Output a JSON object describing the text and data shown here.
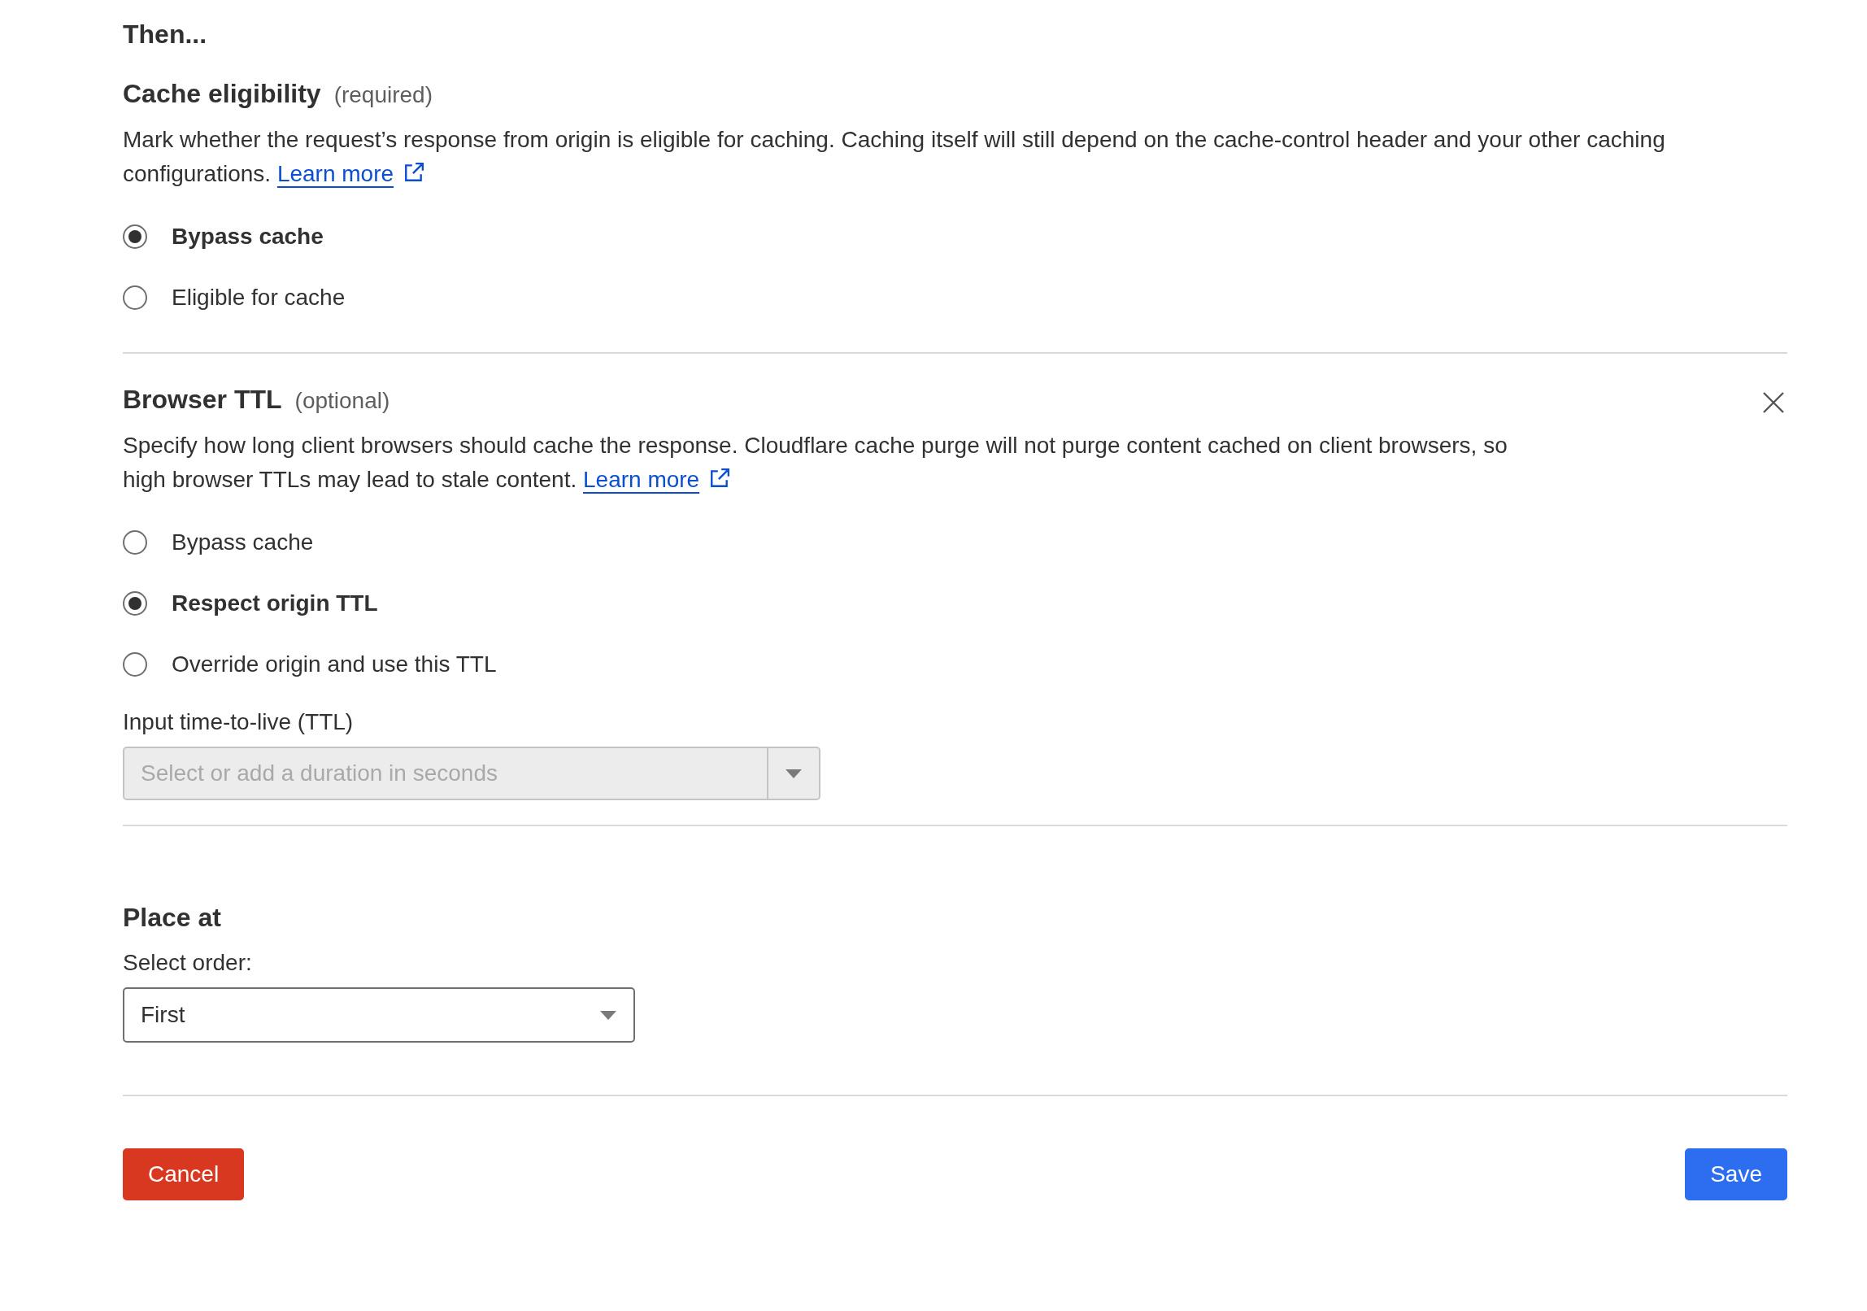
{
  "heading": "Then...",
  "sections": [
    {
      "title": "Cache eligibility",
      "qualifier": "(required)",
      "closable": false,
      "description": "Mark whether the request’s response from origin is eligible for caching. Caching itself will still depend on the cache-control header and your other caching configurations.",
      "link": "Learn more",
      "options": [
        {
          "label": "Bypass cache",
          "selected": true
        },
        {
          "label": "Eligible for cache",
          "selected": false
        }
      ]
    },
    {
      "title": "Browser TTL",
      "qualifier": "(optional)",
      "closable": true,
      "description": "Specify how long client browsers should cache the response. Cloudflare cache purge will not purge content cached on client browsers, so high browser TTLs may lead to stale content.",
      "link": "Learn more",
      "options": [
        {
          "label": "Bypass cache",
          "selected": false
        },
        {
          "label": "Respect origin TTL",
          "selected": true
        },
        {
          "label": "Override origin and use this TTL",
          "selected": false
        }
      ],
      "ttl_field": {
        "label": "Input time-to-live (TTL)",
        "placeholder": "Select or add a duration in seconds",
        "disabled": true
      }
    }
  ],
  "place_at": {
    "title": "Place at",
    "label": "Select order:",
    "value": "First"
  },
  "buttons": [
    {
      "label": "Cancel",
      "kind": "danger"
    },
    {
      "label": "Save",
      "kind": "primary"
    }
  ]
}
